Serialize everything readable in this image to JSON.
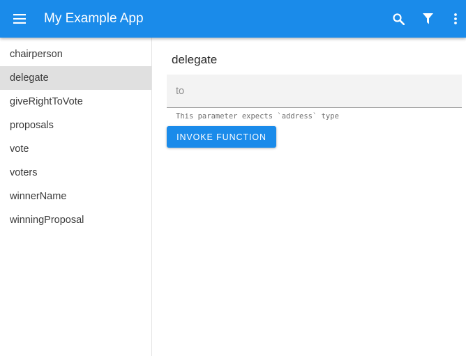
{
  "app_bar": {
    "title": "My Example App",
    "menu_icon": "hamburger-menu-icon",
    "actions": [
      {
        "name": "search",
        "icon": "search-icon"
      },
      {
        "name": "filter",
        "icon": "filter-icon"
      },
      {
        "name": "more",
        "icon": "more-vert-icon"
      }
    ],
    "color": "#1a8bea"
  },
  "sidebar": {
    "items": [
      {
        "label": "chairperson",
        "active": false
      },
      {
        "label": "delegate",
        "active": true
      },
      {
        "label": "giveRightToVote",
        "active": false
      },
      {
        "label": "proposals",
        "active": false
      },
      {
        "label": "vote",
        "active": false
      },
      {
        "label": "voters",
        "active": false
      },
      {
        "label": "winnerName",
        "active": false
      },
      {
        "label": "winningProposal",
        "active": false
      }
    ]
  },
  "main": {
    "function_title": "delegate",
    "param": {
      "placeholder": "to",
      "value": "",
      "hint": "This parameter expects `address` type"
    },
    "invoke_label": "INVOKE FUNCTION"
  },
  "colors": {
    "accent": "#1a8bea",
    "active_item_bg": "#e0e0e0"
  }
}
